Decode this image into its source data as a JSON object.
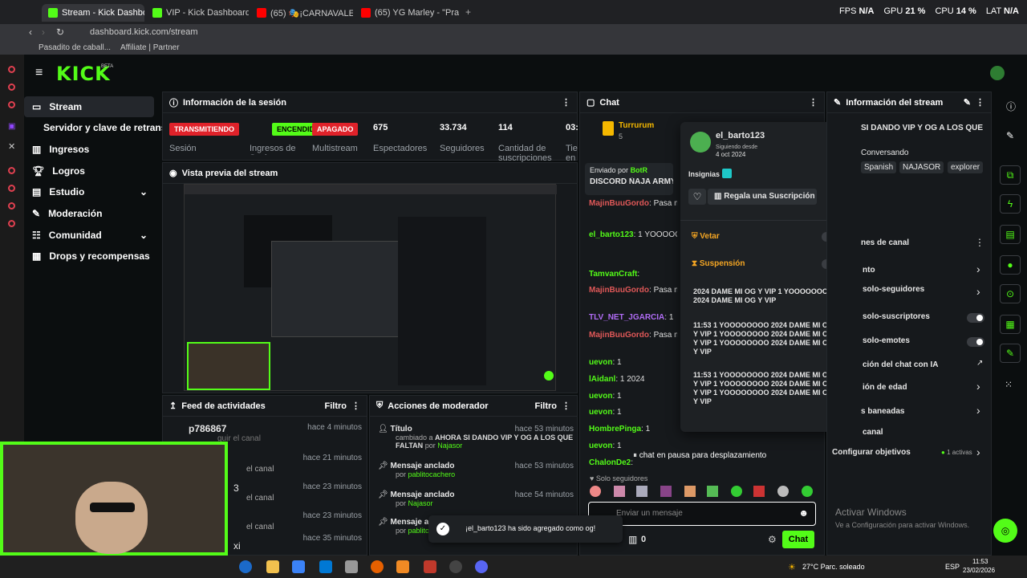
{
  "browser": {
    "tabs": [
      "Stream - Kick Dashboard",
      "VIP - Kick Dashboard",
      "(65) 🎭¡CARNAVALES al A",
      "(65) YG Marley - \"Pra"
    ],
    "url": "dashboard.kick.com/stream",
    "bookmarks": [
      "Pasadito de caball...",
      "Affiliate | Partner"
    ],
    "perf": {
      "fps_label": "FPS",
      "fps": "N/A",
      "gpu_label": "GPU",
      "gpu": "21 %",
      "cpu_label": "CPU",
      "cpu": "14 %",
      "lat_label": "LAT",
      "lat": "N/A"
    }
  },
  "brand": {
    "logo": "KICK",
    "beta": "BETA"
  },
  "nav": [
    "Stream",
    "Servidor y clave de retransm",
    "Ingresos",
    "Logros",
    "Estudio",
    "Moderación",
    "Comunidad",
    "Drops y recompensas"
  ],
  "session": {
    "title": "Información de la sesión",
    "status_live": "TRANSMITIENDO",
    "status_on": "ENCENDIDO",
    "status_off": "APAGADO",
    "lbl_session": "Sesión",
    "lbl_socios": "Ingresos de Socio",
    "lbl_multi": "Multistream",
    "viewers": "675",
    "viewers_lbl": "Espectadores",
    "followers": "33.734",
    "followers_lbl": "Seguidores",
    "subs": "114",
    "subs_lbl": "Cantidad de suscripciones",
    "time": "03:",
    "time_lbl": "Tie en"
  },
  "preview": {
    "title": "Vista previa del stream"
  },
  "feed": {
    "title": "Feed de actividades",
    "filter": "Filtro",
    "items": [
      {
        "user": "p786867",
        "text": "guir el canal",
        "time": "hace 4 minutos"
      },
      {
        "user": "",
        "text": "el canal",
        "time": "hace 21 minutos"
      },
      {
        "user": "3",
        "text": "el canal",
        "time": "hace 23 minutos"
      },
      {
        "user": "",
        "text": "el canal",
        "time": "hace 23 minutos"
      },
      {
        "user": "xi",
        "text": "",
        "time": "hace 35 minutos"
      }
    ]
  },
  "modactions": {
    "title": "Acciones de moderador",
    "filter": "Filtro",
    "items": [
      {
        "title": "Título",
        "time": "hace 53 minutos",
        "desc": "cambiado a",
        "val": "AHORA SI DANDO VIP Y OG A LOS QUE FALTAN",
        "by": "por",
        "user": "Najasor"
      },
      {
        "title": "Mensaje anclado",
        "time": "hace 53 minutos",
        "by": "por",
        "user": "pablitocachero"
      },
      {
        "title": "Mensaje anclado",
        "time": "hace 54 minutos",
        "by": "por",
        "user": "Najasor"
      },
      {
        "title": "Mensaje a",
        "time": "",
        "by": "por",
        "user": "pablito"
      }
    ]
  },
  "chat": {
    "title": "Chat",
    "top_user": "Turrurum",
    "top_count": "5",
    "pinned_by": "Enviado por",
    "pinned_bot": "BotR",
    "pinned_text": "DISCORD ÑAJA ARMY",
    "lines": [
      {
        "user": "MajinBuuGordo",
        "text": "Pasa mi HOLD @Najasor"
      },
      {
        "user": "el_barto123",
        "text": "1 YOOOOOOOO 2024 1 YOOOOOOOO 2024"
      },
      {
        "user": "TamvanCraft",
        "text": ""
      },
      {
        "user": "MajinBuuGordo",
        "text": "Pasa mi HOLD @Najasor"
      },
      {
        "user": "TLV_NET_JGARCIA",
        "text": "1"
      },
      {
        "user": "MajinBuuGordo",
        "text": "Pasa mi HOLD @Najasor"
      },
      {
        "user": "uevon",
        "text": "1"
      },
      {
        "user": "lAidanl",
        "text": "1 2024"
      },
      {
        "user": "uevon",
        "text": "1"
      },
      {
        "user": "uevon",
        "text": "1"
      },
      {
        "user": "HombrePinga",
        "text": "1"
      },
      {
        "user": "uevon",
        "text": "1"
      },
      {
        "user": "ChalonDe2",
        "text": ""
      }
    ],
    "paused": "chat en pausa para desplazamiento",
    "followers_only": "Solo seguidores",
    "placeholder": "Enviar un mensaje",
    "count": "0",
    "send": "Chat"
  },
  "popup": {
    "user": "el_barto123",
    "since_lbl": "Siguiendo desde",
    "since": "4 oct 2024",
    "badges": "Insignias",
    "gift": "Regala una Suscripción",
    "veto": "Vetar",
    "suspension": "Suspensión",
    "msgs": [
      "2024 DAME MI OG Y VIP 1 YOOOOOOOO 2024 DAME MI OG Y VIP",
      "11:53 1 YOOOOOOOO 2024 DAME MI OG Y VIP 1 YOOOOOOOO 2024 DAME MI OG Y VIP 1 YOOOOOOOO 2024 DAME MI OG Y VIP",
      "11:53 1 YOOOOOOOO 2024 DAME MI OG Y VIP 1 YOOOOOOOO 2024 DAME MI OG Y VIP 1 YOOOOOOOO 2024 DAME MI OG Y VIP"
    ]
  },
  "info": {
    "title": "Información del stream",
    "stream_title": "SI DANDO VIP Y OG A LOS QUE",
    "category": "Conversando",
    "tags": [
      "Spanish",
      "NAJASOR",
      "explorer"
    ],
    "section": "nes de canal",
    "rows": [
      "nto",
      "solo-seguidores",
      "solo-suscriptores",
      "solo-emotes",
      "ción del chat con IA",
      "ión de edad",
      "s baneadas",
      "canal"
    ],
    "goals": "Configurar objetivos",
    "goals_active": "1 activas"
  },
  "toast": "¡el_barto123 ha sido agregado como og!",
  "windows": {
    "activate": "Activar Windows",
    "hint": "Ve a Configuración para activar Windows."
  },
  "taskbar": {
    "weather": "27°C  Parc. soleado",
    "lang": "ESP",
    "time": "11:53",
    "date": "23/02/2026"
  }
}
